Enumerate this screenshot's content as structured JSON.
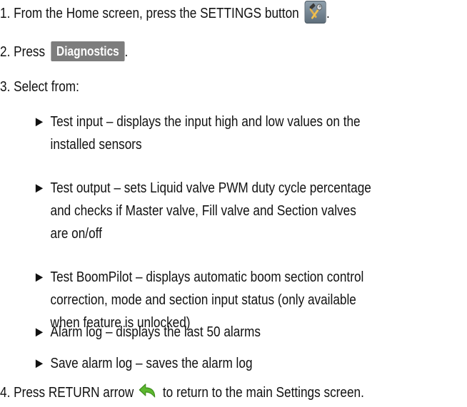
{
  "steps": {
    "step1": {
      "text": "1. From the Home screen, press the SETTINGS button",
      "suffix": ".",
      "icon": "settings-tools-icon"
    },
    "step2": {
      "prefix": "2. Press",
      "button_label": "Diagnostics",
      "suffix": "."
    },
    "step3": {
      "text": "3. Select from:"
    },
    "step4": {
      "prefix": "4. Press RETURN arrow",
      "suffix": "to return to the main Settings screen.",
      "icon": "return-arrow-icon"
    }
  },
  "bullets": [
    {
      "marker": "►",
      "lines": [
        "Test input – displays the input high and low values on the",
        "installed sensors"
      ]
    },
    {
      "marker": "►",
      "lines": [
        "Test output – sets Liquid valve PWM duty cycle percentage",
        "and checks if Master valve, Fill valve and Section valves",
        "are on/off"
      ]
    },
    {
      "marker": "►",
      "lines": [
        "Test BoomPilot – displays automatic boom section control",
        "correction, mode and section input status (only available",
        "when feature is unlocked)"
      ]
    },
    {
      "marker": "►",
      "lines": [
        "Alarm log – displays the last 50 alarms"
      ]
    },
    {
      "marker": "►",
      "lines": [
        "Save alarm log – saves the alarm log"
      ]
    }
  ],
  "colors": {
    "button_bg": "#7d7d7d",
    "button_text": "#ffffff",
    "return_arrow": "#5cb82e",
    "text": "#111111"
  }
}
